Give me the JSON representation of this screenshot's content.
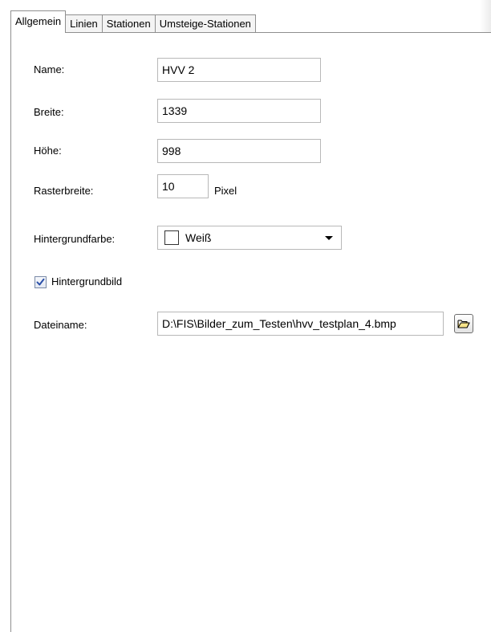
{
  "tabs": [
    "Allgemein",
    "Linien",
    "Stationen",
    "Umsteige-Stationen"
  ],
  "form": {
    "name_label": "Name:",
    "name_value": "HVV 2",
    "breite_label": "Breite:",
    "breite_value": "1339",
    "hoehe_label": "Höhe:",
    "hoehe_value": "998",
    "raster_label": "Rasterbreite:",
    "raster_value": "10",
    "raster_unit": "Pixel",
    "hintergrundfarbe_label": "Hintergrundfarbe:",
    "hintergrundfarbe_value": "Weiß",
    "hintergrundfarbe_swatch_color": "#ffffff",
    "hintergrundbild_label": "Hintergrundbild",
    "hintergrundbild_checked": true,
    "dateiname_label": "Dateiname:",
    "dateiname_value": "D:\\FIS\\Bilder_zum_Testen\\hvv_testplan_4.bmp"
  },
  "icons": {
    "browse": "folder-open-icon",
    "check": "checkmark-icon",
    "dropdown": "chevron-down-icon"
  }
}
